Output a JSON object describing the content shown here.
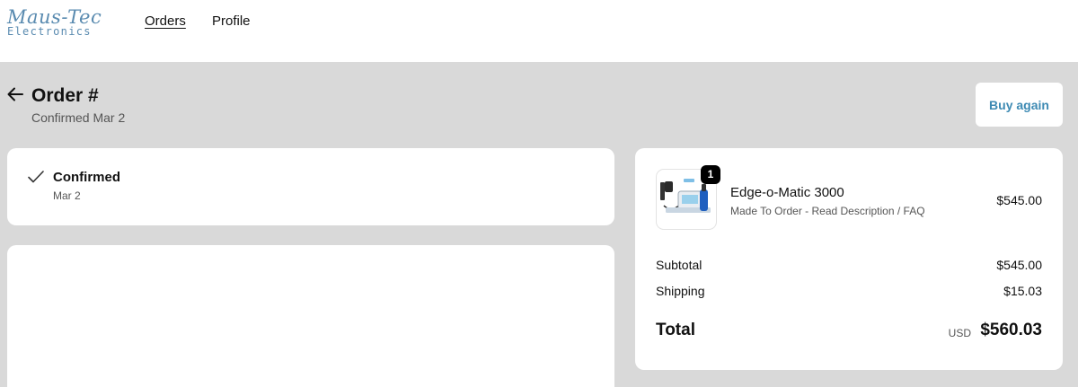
{
  "header": {
    "logo_line1": "Maus-Tec",
    "logo_line2": "Electronics",
    "nav": [
      {
        "label": "Orders"
      },
      {
        "label": "Profile"
      }
    ]
  },
  "page": {
    "back_icon": "arrow-left-icon",
    "title": "Order #",
    "subtitle": "Confirmed Mar 2",
    "buy_again_label": "Buy again"
  },
  "status": {
    "icon": "checkmark-icon",
    "title": "Confirmed",
    "date": "Mar 2"
  },
  "order_summary": {
    "item": {
      "quantity": "1",
      "name": "Edge-o-Matic 3000",
      "variant": "Made To Order - Read Description / FAQ",
      "price": "$545.00"
    },
    "subtotal_label": "Subtotal",
    "subtotal_value": "$545.00",
    "shipping_label": "Shipping",
    "shipping_value": "$15.03",
    "total_label": "Total",
    "currency": "USD",
    "total_value": "$560.03"
  },
  "colors": {
    "accent": "#3d8ab3",
    "background": "#d9d9d9",
    "logo": "#5a8bb0"
  }
}
